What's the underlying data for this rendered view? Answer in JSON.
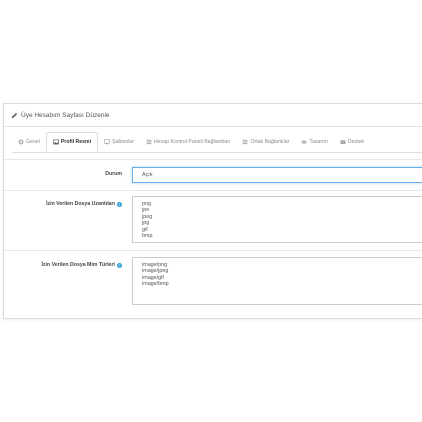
{
  "panel": {
    "title": "Üye Hesabım Sayfası Düzenle"
  },
  "tabs": [
    {
      "label": "Genel",
      "icon": "gears-icon",
      "active": false
    },
    {
      "label": "Profil Resmi",
      "icon": "image-icon",
      "active": true
    },
    {
      "label": "Şablonlar",
      "icon": "monitor-icon",
      "active": false
    },
    {
      "label": "Hesap Kontrol Paneli Bağlantıları",
      "icon": "list-icon",
      "active": false
    },
    {
      "label": "Ortak Bağlantılar",
      "icon": "list-icon",
      "active": false
    },
    {
      "label": "Tasarım",
      "icon": "eye-icon",
      "active": false
    },
    {
      "label": "Destek",
      "icon": "envelope-icon",
      "active": false
    }
  ],
  "form": {
    "status_label": "Durum",
    "status_value": "Açık",
    "extensions_label": "İzin Verilen Dosya Uzantıları",
    "extensions": [
      "png",
      "jpe",
      "jpeg",
      "jpg",
      "gif",
      "bmp"
    ],
    "mime_label": "İzin Verilen Dosya Mim Türleri",
    "mime_types": [
      "image/png",
      "image/jpeg",
      "image/gif",
      "image/bmp"
    ]
  },
  "colors": {
    "accent": "#66afe9",
    "help": "#2a9fd6"
  }
}
